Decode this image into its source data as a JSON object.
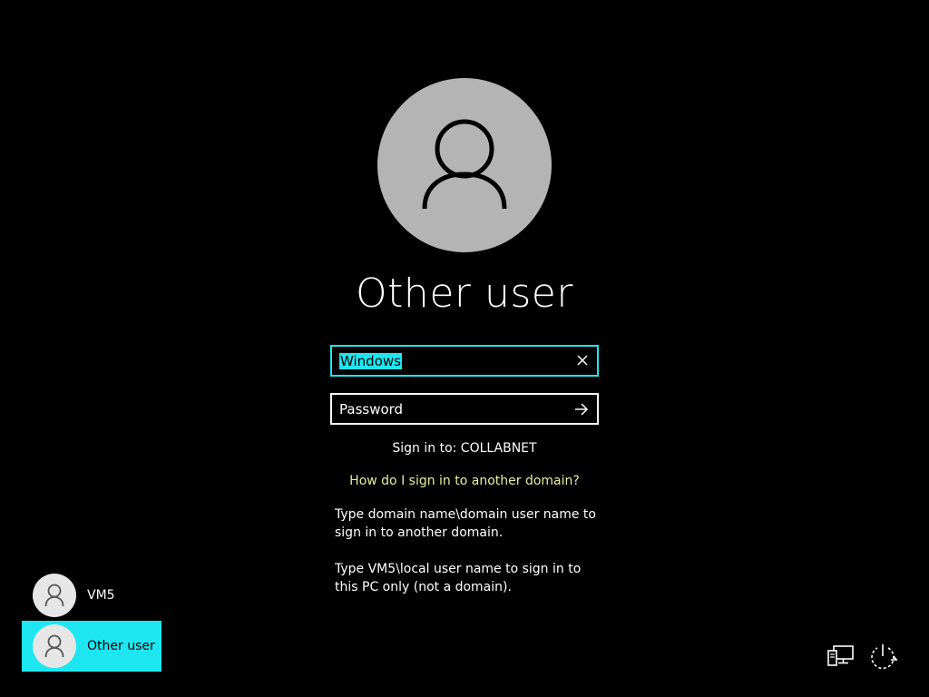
{
  "user": {
    "name": "Other user"
  },
  "username_field": {
    "value_selected": "Windows",
    "clear_icon": "close-icon"
  },
  "password_field": {
    "placeholder": "Password",
    "submit_icon": "arrow-right-icon"
  },
  "signin_to": "Sign in to: COLLABNET",
  "help_link": "How do I sign in to another domain?",
  "hints": [
    "Type domain name\\domain user name to sign in to another domain.",
    "Type VM5\\local user name to sign in to this PC only (not a domain)."
  ],
  "user_list": [
    {
      "label": "VM5",
      "selected": false,
      "icon": "user-icon"
    },
    {
      "label": "Other user",
      "selected": true,
      "icon": "user-icon"
    }
  ],
  "system_icons": {
    "network": "network-icon",
    "power": "power-icon"
  },
  "colors": {
    "background": "#000000",
    "accent": "#1ee6f0",
    "link": "#ecec9e",
    "avatar": "#b4b4b4"
  }
}
